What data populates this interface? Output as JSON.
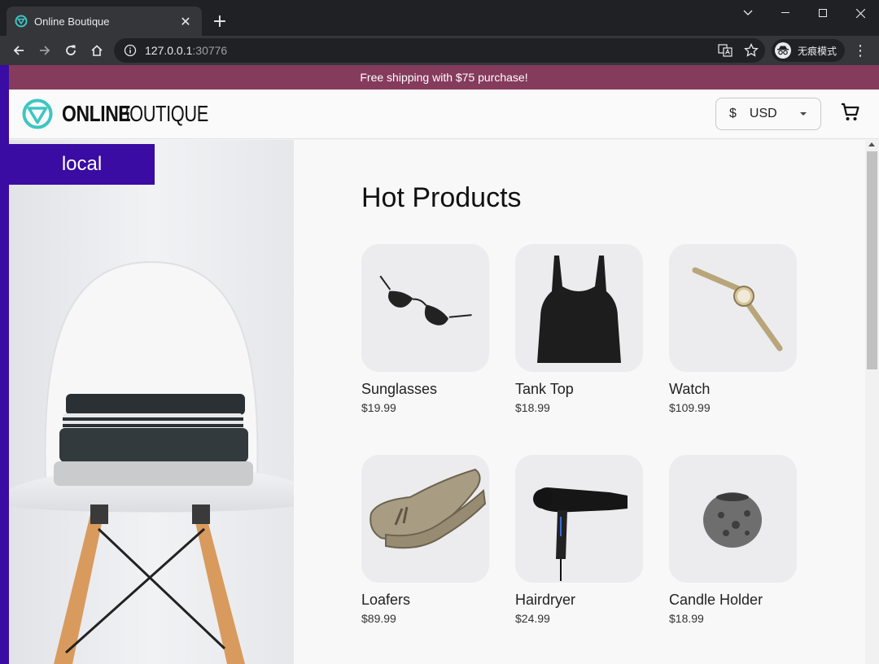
{
  "browser": {
    "tab_title": "Online Boutique",
    "url_host": "127.0.0.1",
    "url_port": ":30776",
    "profile_label": "无痕模式"
  },
  "site": {
    "banner": "Free shipping with $75 purchase!",
    "logo_primary": "ONLINE",
    "logo_secondary": "BOUTIQUE",
    "currency_symbol": "$",
    "currency_code": "USD",
    "cluster_label": "local"
  },
  "products": {
    "title": "Hot Products",
    "items": [
      {
        "name": "Sunglasses",
        "price": "$19.99",
        "icon": "sunglasses-icon"
      },
      {
        "name": "Tank Top",
        "price": "$18.99",
        "icon": "tank-top-icon"
      },
      {
        "name": "Watch",
        "price": "$109.99",
        "icon": "watch-icon"
      },
      {
        "name": "Loafers",
        "price": "$89.99",
        "icon": "loafers-icon"
      },
      {
        "name": "Hairdryer",
        "price": "$24.99",
        "icon": "hairdryer-icon"
      },
      {
        "name": "Candle Holder",
        "price": "$18.99",
        "icon": "candle-holder-icon"
      }
    ]
  },
  "colors": {
    "banner": "#853b5c",
    "accent_purple": "#3a0ca3",
    "logo_teal": "#3cc6c3"
  }
}
